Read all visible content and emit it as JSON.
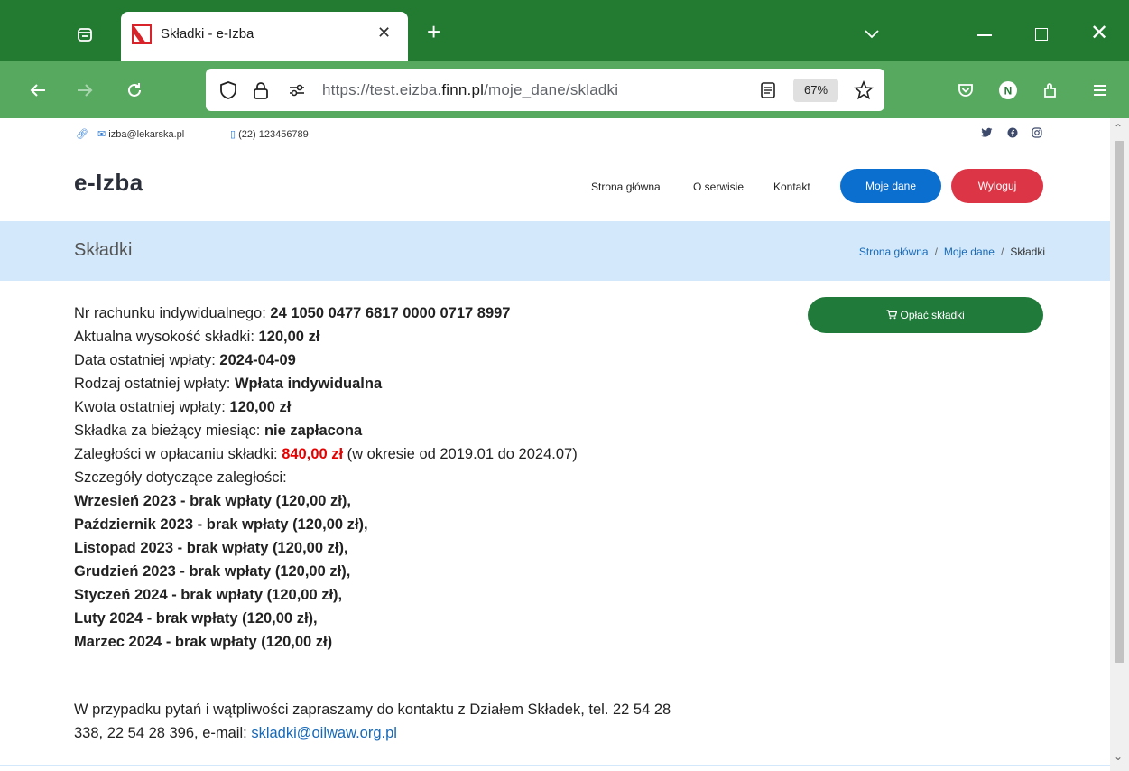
{
  "browser": {
    "tab_title": "Składki - e-Izba",
    "url_host_prefix": "https://test.eizba.",
    "url_host_domain": "finn.pl",
    "url_path": "/moje_dane/skladki",
    "zoom": "67%",
    "accent": "#237b32",
    "nav_bg": "#58a960"
  },
  "topbar": {
    "email": "izba@lekarska.pl",
    "phone": "(22) 123456789"
  },
  "header": {
    "logo": "e-Izba",
    "menu": [
      "Strona główna",
      "O serwisie",
      "Kontakt"
    ],
    "btn_my_data": "Moje dane",
    "btn_logout": "Wyloguj"
  },
  "breadcrumb": {
    "title": "Składki",
    "items": [
      "Strona główna",
      "Moje dane",
      "Składki"
    ]
  },
  "details": {
    "account_label": "Nr rachunku indywidualnego: ",
    "account_value": "24 1050 0477 6817 0000 0717 8997",
    "fee_label": "Aktualna wysokość składki: ",
    "fee_value": "120,00 zł",
    "last_date_label": "Data ostatniej wpłaty: ",
    "last_date_value": "2024-04-09",
    "last_type_label": "Rodzaj ostatniej wpłaty: ",
    "last_type_value": "Wpłata indywidualna",
    "last_amount_label": "Kwota ostatniej wpłaty: ",
    "last_amount_value": "120,00 zł",
    "current_label": "Składka za bieżący miesiąc: ",
    "current_value": "nie zapłacona",
    "arrears_label": "Zaległości w opłacaniu składki: ",
    "arrears_value": "840,00 zł",
    "arrears_period": " (w okresie od 2019.01 do 2024.07)",
    "arrears_details_label": "Szczegóły dotyczące zaległości:",
    "arrears_items": [
      "Wrzesień 2023 - brak wpłaty (120,00 zł),",
      "Październik 2023 - brak wpłaty (120,00 zł),",
      "Listopad 2023 - brak wpłaty (120,00 zł),",
      "Grudzień 2023 - brak wpłaty (120,00 zł),",
      "Styczeń 2024 - brak wpłaty (120,00 zł),",
      "Luty 2024 - brak wpłaty (120,00 zł),",
      "Marzec 2024 - brak wpłaty (120,00 zł)"
    ]
  },
  "contact": {
    "text_line1": "W przypadku pytań i wątpliwości zapraszamy do kontaktu z Działem Składek, tel. 22 54 28",
    "text_line2": "338, 22 54 28 396, e-mail: ",
    "email": "skladki@oilwaw.org.pl"
  },
  "pay_button": "Opłać składki",
  "colors": {
    "btn_blue": "#0b6fd0",
    "btn_red": "#dc3545",
    "btn_green": "#207a3a",
    "crumb_bg": "#d3e9fb",
    "arrears_red": "#e60000"
  }
}
